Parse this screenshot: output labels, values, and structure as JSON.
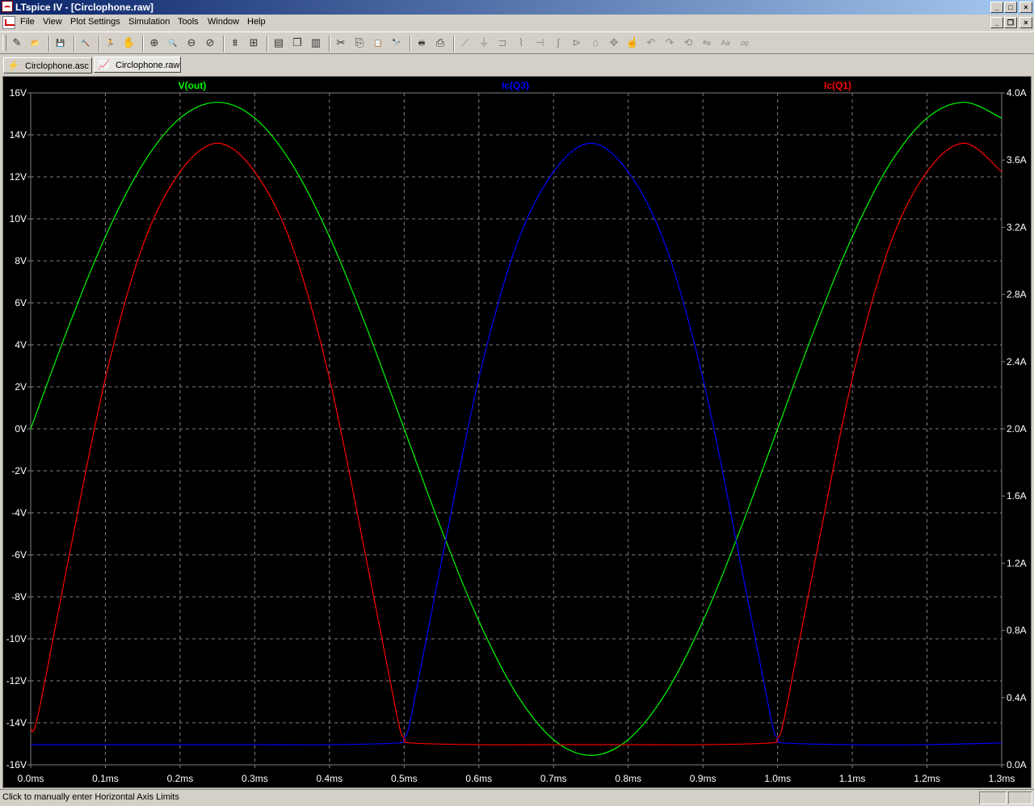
{
  "window": {
    "title": "LTspice IV - [Circlophone.raw]"
  },
  "menu": [
    "File",
    "View",
    "Plot Settings",
    "Simulation",
    "Tools",
    "Window",
    "Help"
  ],
  "toolbar": [
    {
      "name": "new-schematic-icon",
      "glyph": "✎"
    },
    {
      "name": "open-icon",
      "glyph": "📂"
    },
    {
      "sep": true
    },
    {
      "name": "save-icon",
      "glyph": "💾"
    },
    {
      "sep": true
    },
    {
      "name": "control-panel-icon",
      "glyph": "🔨"
    },
    {
      "sep": true
    },
    {
      "name": "run-icon",
      "glyph": "🏃"
    },
    {
      "name": "halt-icon",
      "glyph": "✋"
    },
    {
      "sep": true
    },
    {
      "name": "zoom-in-icon",
      "glyph": "⊕"
    },
    {
      "name": "zoom-out-icon",
      "glyph": "🔍"
    },
    {
      "name": "zoom-fit-icon",
      "glyph": "⊖"
    },
    {
      "name": "zoom-cancel-icon",
      "glyph": "⊘"
    },
    {
      "sep": true
    },
    {
      "name": "autorange-icon",
      "glyph": "⩩"
    },
    {
      "name": "fit-icon",
      "glyph": "⊞"
    },
    {
      "sep": true
    },
    {
      "name": "tile-horizontal-icon",
      "glyph": "▤"
    },
    {
      "name": "cascade-icon",
      "glyph": "❐"
    },
    {
      "name": "tile-vertical-icon",
      "glyph": "▥"
    },
    {
      "sep": true
    },
    {
      "name": "cut-icon",
      "glyph": "✂"
    },
    {
      "name": "copy-icon",
      "glyph": "⎘"
    },
    {
      "name": "paste-icon",
      "glyph": "📋"
    },
    {
      "name": "find-icon",
      "glyph": "🔭"
    },
    {
      "sep": true
    },
    {
      "name": "print-setup-icon",
      "glyph": "🖶"
    },
    {
      "name": "print-icon",
      "glyph": "⎙"
    },
    {
      "sep": true
    },
    {
      "name": "wire-icon",
      "glyph": "⟋",
      "dim": true
    },
    {
      "name": "ground-icon",
      "glyph": "⏚",
      "dim": true
    },
    {
      "name": "label-icon",
      "glyph": "⊐",
      "dim": true
    },
    {
      "name": "resistor-icon",
      "glyph": "⌇",
      "dim": true
    },
    {
      "name": "capacitor-icon",
      "glyph": "⊣",
      "dim": true
    },
    {
      "name": "inductor-icon",
      "glyph": "∫",
      "dim": true
    },
    {
      "name": "diode-icon",
      "glyph": "⊳",
      "dim": true
    },
    {
      "name": "component-icon",
      "glyph": "⌂",
      "dim": true
    },
    {
      "name": "move-icon",
      "glyph": "✥",
      "dim": true
    },
    {
      "name": "drag-icon",
      "glyph": "☝",
      "dim": true
    },
    {
      "name": "undo-icon",
      "glyph": "↶",
      "dim": true
    },
    {
      "name": "redo-icon",
      "glyph": "↷",
      "dim": true
    },
    {
      "name": "rotate-icon",
      "glyph": "⟲",
      "dim": true
    },
    {
      "name": "mirror-icon",
      "glyph": "⇋",
      "dim": true
    },
    {
      "name": "text-icon",
      "glyph": "Aa",
      "dim": true
    },
    {
      "name": "spice-directive-icon",
      "glyph": ".op",
      "dim": true
    }
  ],
  "tabs": [
    {
      "label": "Circlophone.asc",
      "icon": "schematic-icon",
      "glyph": "⚡",
      "active": false
    },
    {
      "label": "Circlophone.raw",
      "icon": "waveform-icon",
      "glyph": "📈",
      "active": true
    }
  ],
  "status": {
    "text": "Click to manually enter Horizontal Axis Limits"
  },
  "colors": {
    "v_out": "#00ff00",
    "ic_q3": "#0000ff",
    "ic_q1": "#ff0000",
    "grid": "#808080",
    "axis_text": "#ffffff"
  },
  "chart_data": {
    "type": "line",
    "x_axis": {
      "unit": "ms",
      "range": [
        0,
        1.3
      ],
      "ticks": [
        "0.0ms",
        "0.1ms",
        "0.2ms",
        "0.3ms",
        "0.4ms",
        "0.5ms",
        "0.6ms",
        "0.7ms",
        "0.8ms",
        "0.9ms",
        "1.0ms",
        "1.1ms",
        "1.2ms",
        "1.3ms"
      ]
    },
    "y_left": {
      "unit": "V",
      "range": [
        -16,
        16
      ],
      "ticks": [
        "16V",
        "14V",
        "12V",
        "10V",
        "8V",
        "6V",
        "4V",
        "2V",
        "0V",
        "-2V",
        "-4V",
        "-6V",
        "-8V",
        "-10V",
        "-12V",
        "-14V",
        "-16V"
      ]
    },
    "y_right": {
      "unit": "A",
      "range": [
        0,
        4
      ],
      "ticks": [
        "4.0A",
        "3.6A",
        "3.2A",
        "2.8A",
        "2.4A",
        "2.0A",
        "1.6A",
        "1.2A",
        "0.8A",
        "0.4A",
        "0.0A"
      ]
    },
    "grid": true,
    "series": [
      {
        "name": "V(out)",
        "axis": "left",
        "color": "#00ff00",
        "x": [
          0,
          0.05,
          0.1,
          0.15,
          0.2,
          0.25,
          0.3,
          0.35,
          0.4,
          0.45,
          0.5,
          0.55,
          0.6,
          0.65,
          0.7,
          0.75,
          0.8,
          0.85,
          0.9,
          0.95,
          1.0,
          1.05,
          1.1,
          1.15,
          1.2,
          1.25,
          1.3
        ],
        "y": [
          0,
          4.8,
          9.15,
          12.6,
          14.8,
          15.55,
          14.8,
          12.6,
          9.15,
          4.8,
          0,
          -4.8,
          -9.15,
          -12.6,
          -14.8,
          -15.55,
          -14.8,
          -12.6,
          -9.15,
          -4.8,
          0,
          4.8,
          9.15,
          12.6,
          14.8,
          15.55,
          14.8
        ]
      },
      {
        "name": "Ic(Q3)",
        "axis": "right",
        "color": "#0000ff",
        "x": [
          0,
          0.05,
          0.1,
          0.2,
          0.3,
          0.4,
          0.49,
          0.5,
          0.51,
          0.55,
          0.6,
          0.65,
          0.7,
          0.75,
          0.8,
          0.85,
          0.9,
          0.95,
          0.99,
          1.0,
          1.01,
          1.1,
          1.2,
          1.3
        ],
        "y": [
          0.12,
          0.12,
          0.12,
          0.12,
          0.12,
          0.12,
          0.13,
          0.16,
          0.3,
          1.21,
          2.3,
          3.09,
          3.53,
          3.7,
          3.53,
          3.09,
          2.3,
          1.21,
          0.3,
          0.16,
          0.13,
          0.12,
          0.12,
          0.13
        ]
      },
      {
        "name": "Ic(Q1)",
        "axis": "right",
        "color": "#ff0000",
        "x": [
          0,
          0.01,
          0.05,
          0.1,
          0.15,
          0.2,
          0.25,
          0.3,
          0.35,
          0.4,
          0.45,
          0.49,
          0.5,
          0.51,
          0.6,
          0.7,
          0.8,
          0.9,
          0.99,
          1.0,
          1.01,
          1.05,
          1.1,
          1.15,
          1.2,
          1.25,
          1.3
        ],
        "y": [
          0.21,
          0.3,
          1.21,
          2.3,
          3.09,
          3.53,
          3.7,
          3.53,
          3.09,
          2.3,
          1.21,
          0.3,
          0.16,
          0.13,
          0.12,
          0.12,
          0.12,
          0.12,
          0.13,
          0.16,
          0.3,
          1.21,
          2.3,
          3.09,
          3.53,
          3.7,
          3.53
        ]
      }
    ]
  }
}
